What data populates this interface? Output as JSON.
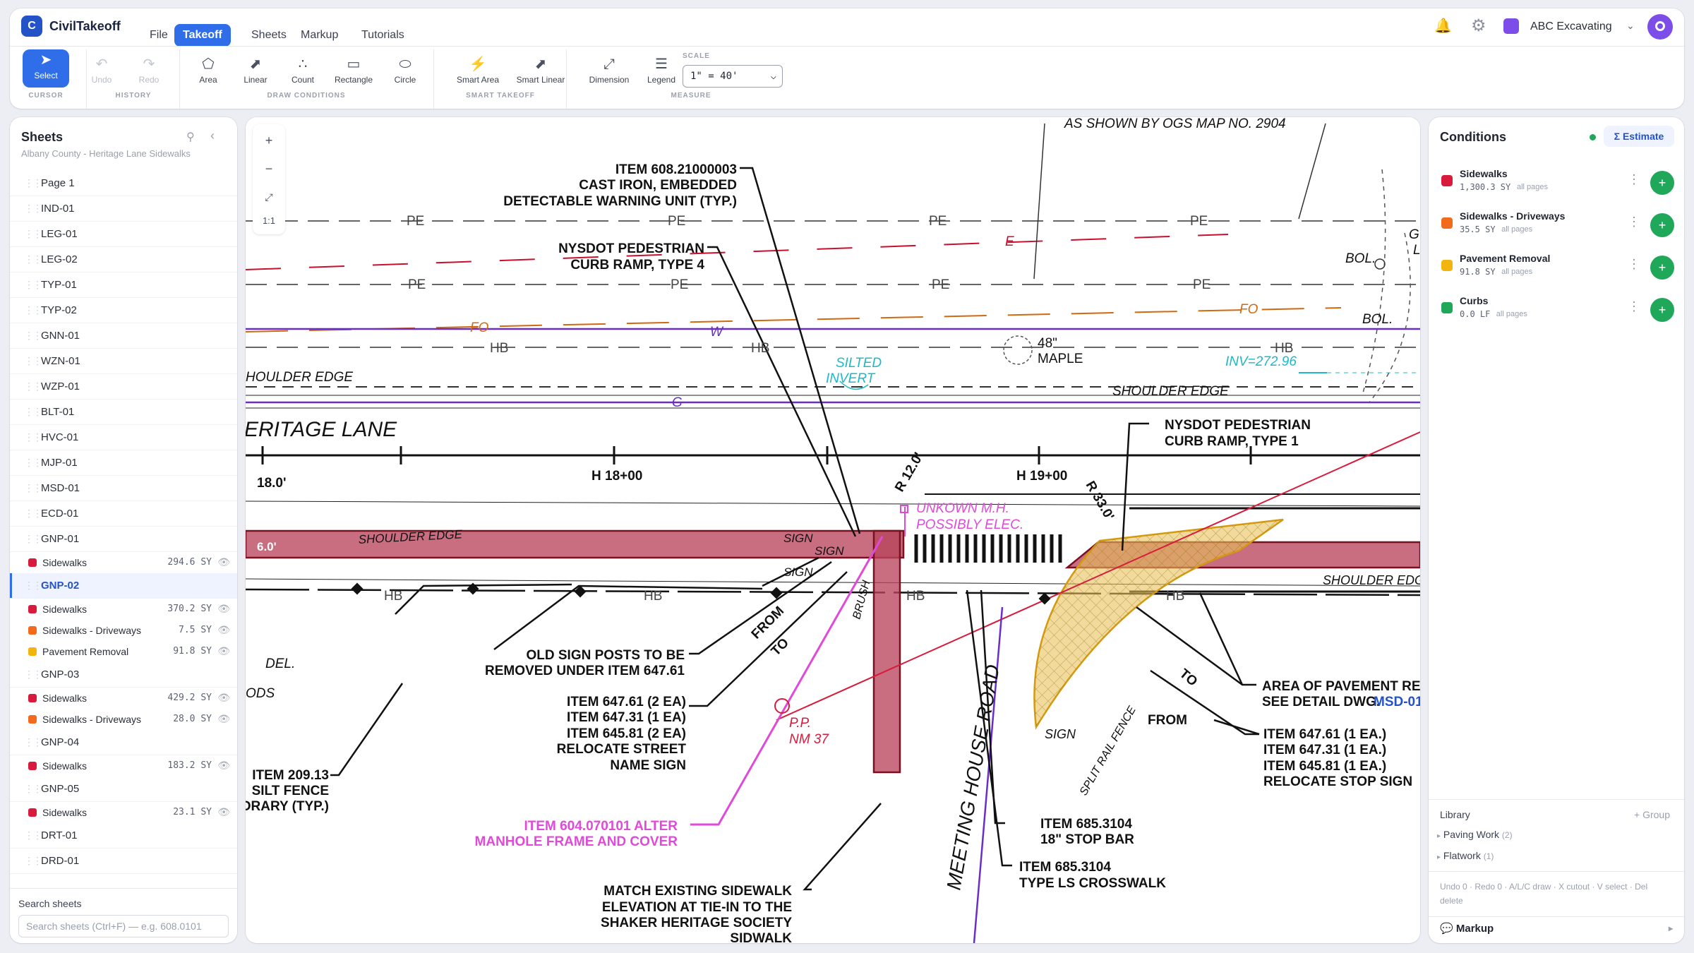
{
  "app": {
    "logo_letter": "C",
    "name": "CivilTakeoff"
  },
  "menu": {
    "file": "File",
    "takeoff": "Takeoff",
    "sheets": "Sheets",
    "markup": "Markup",
    "tutorials": "Tutorials"
  },
  "account": {
    "company": "ABC Excavating"
  },
  "toolbar": {
    "select": "Select",
    "undo": "Undo",
    "redo": "Redo",
    "area": "Area",
    "linear": "Linear",
    "count": "Count",
    "rectangle": "Rectangle",
    "circle": "Circle",
    "smart_area": "Smart Area",
    "smart_linear": "Smart Linear",
    "dimension": "Dimension",
    "legend": "Legend",
    "scale_label": "SCALE",
    "scale_value": "1\" = 40'",
    "groups": {
      "cursor": "CURSOR",
      "history": "HISTORY",
      "draw": "DRAW CONDITIONS",
      "smart": "SMART TAKEOFF",
      "measure": "MEASURE"
    }
  },
  "sheets_panel": {
    "title": "Sheets",
    "subtitle": "Albany County - Heritage Lane Sidewalks",
    "search_label": "Search sheets",
    "search_placeholder": "Search sheets (Ctrl+F) — e.g. 608.0101",
    "rows": [
      {
        "kind": "sheet",
        "name": "Page 1"
      },
      {
        "kind": "sheet",
        "name": "IND-01"
      },
      {
        "kind": "sheet",
        "name": "LEG-01"
      },
      {
        "kind": "sheet",
        "name": "LEG-02"
      },
      {
        "kind": "sheet",
        "name": "TYP-01"
      },
      {
        "kind": "sheet",
        "name": "TYP-02"
      },
      {
        "kind": "sheet",
        "name": "GNN-01"
      },
      {
        "kind": "sheet",
        "name": "WZN-01"
      },
      {
        "kind": "sheet",
        "name": "WZP-01"
      },
      {
        "kind": "sheet",
        "name": "BLT-01"
      },
      {
        "kind": "sheet",
        "name": "HVC-01"
      },
      {
        "kind": "sheet",
        "name": "MJP-01"
      },
      {
        "kind": "sheet",
        "name": "MSD-01"
      },
      {
        "kind": "sheet",
        "name": "ECD-01"
      },
      {
        "kind": "sheet",
        "name": "GNP-01"
      },
      {
        "kind": "cond",
        "name": "Sidewalks",
        "value": "294.6 SY",
        "color": "#d81b3c"
      },
      {
        "kind": "sheet",
        "name": "GNP-02",
        "active": true
      },
      {
        "kind": "cond",
        "name": "Sidewalks",
        "value": "370.2 SY",
        "color": "#d81b3c"
      },
      {
        "kind": "cond",
        "name": "Sidewalks - Driveways",
        "value": "7.5 SY",
        "color": "#f26a1b"
      },
      {
        "kind": "cond",
        "name": "Pavement Removal",
        "value": "91.8 SY",
        "color": "#f2b40f"
      },
      {
        "kind": "sheet",
        "name": "GNP-03"
      },
      {
        "kind": "cond",
        "name": "Sidewalks",
        "value": "429.2 SY",
        "color": "#d81b3c"
      },
      {
        "kind": "cond",
        "name": "Sidewalks - Driveways",
        "value": "28.0 SY",
        "color": "#f26a1b"
      },
      {
        "kind": "sheet",
        "name": "GNP-04"
      },
      {
        "kind": "cond",
        "name": "Sidewalks",
        "value": "183.2 SY",
        "color": "#d81b3c"
      },
      {
        "kind": "sheet",
        "name": "GNP-05"
      },
      {
        "kind": "cond",
        "name": "Sidewalks",
        "value": "23.1 SY",
        "color": "#d81b3c"
      },
      {
        "kind": "sheet",
        "name": "DRT-01"
      },
      {
        "kind": "sheet",
        "name": "DRD-01"
      }
    ]
  },
  "canvas_controls": {
    "zoom_in": "+",
    "zoom_out": "−",
    "fit": "⤢",
    "ratio": "1:1"
  },
  "drawing": {
    "notes": {
      "ogs": "AS SHOWN BY OGS MAP NO. 2904",
      "item608_1": "ITEM 608.21000003",
      "item608_2": "CAST IRON, EMBEDDED",
      "item608_3": "DETECTABLE WARNING UNIT (TYP.)",
      "ramp4_1": "NYSDOT PEDESTRIAN",
      "ramp4_2": "CURB RAMP, TYPE 4",
      "ramp1_1": "NYSDOT PEDESTRIAN",
      "ramp1_2": "CURB RAMP, TYPE 1",
      "silted_1": "SILTED",
      "silted_2": "INVERT",
      "maple_1": "48\"",
      "maple_2": "MAPLE",
      "inv": "INV=272.96",
      "shoulder_left": "HOULDER EDGE",
      "shoulder_mid": "SHOULDER EDGE",
      "shoulder_walk": "SHOULDER EDGE",
      "shoulder_right": "SHOULDER EDG",
      "street": "ERITAGE LANE",
      "dim18": "18.0'",
      "dim6": "6.0'",
      "sta18": "H 18+00",
      "sta19": "H 19+00",
      "r12": "R 12.0'",
      "r33": "R 33.0'",
      "unk_1": "UNKOWN M.H.",
      "unk_2": "POSSIBLY ELEC.",
      "bol1": "BOL.",
      "bol2": "BOL.",
      "oldsign_1": "OLD SIGN POSTS TO BE",
      "oldsign_2": "REMOVED UNDER ITEM 647.61",
      "item647a_1": "ITEM 647.61 (2 EA)",
      "item647a_2": "ITEM 647.31 (1 EA)",
      "item647a_3": "ITEM 645.81 (2 EA)",
      "item647a_4": "RELOCATE STREET",
      "item647a_5": "NAME SIGN",
      "silt_1": "ITEM 209.13",
      "silt_2": "SILT FENCE",
      "silt_3": "ORARY (TYP.)",
      "del": "DEL.",
      "ods": "ODS",
      "manhole_1": "ITEM 604.070101 ALTER",
      "manhole_2": "MANHOLE FRAME AND COVER",
      "pp_1": "P.P.",
      "pp_2": "NM 37",
      "match_1": "MATCH EXISTING SIDEWALK",
      "match_2": "ELEVATION AT TIE-IN TO THE",
      "match_3": "SHAKER HERITAGE SOCIETY",
      "match_4": "SIDWALK",
      "road": "MEETING HOUSE ROAD",
      "stopbar_1": "ITEM 685.3104",
      "stopbar_2": "18\" STOP BAR",
      "cross_1": "ITEM 685.3104",
      "cross_2": "TYPE LS CROSSWALK",
      "pave_1": "AREA OF PAVEMENT REMO",
      "pave_2": "SEE DETAIL DWG.",
      "pave_3": "MSD-01",
      "item647b_1": "ITEM 647.61 (1 EA.)",
      "item647b_2": "ITEM 647.31 (1 EA.)",
      "item647b_3": "ITEM 645.81 (1 EA.)",
      "item647b_4": "RELOCATE STOP SIGN",
      "from": "FROM",
      "to": "TO",
      "from2": "FROM",
      "to2": "TO",
      "sign": "SIGN",
      "sign2": "SIGN",
      "sign3": "SIGN",
      "sign4": "SIGN",
      "brush": "BRUSH",
      "split": "SPLIT RAIL FENCE",
      "pe": "PE",
      "hb": "HB",
      "fo": "FO",
      "w": "W",
      "g": "G",
      "e": "E",
      "gl1": "G",
      "gl2": "L"
    }
  },
  "conditions_panel": {
    "title": "Conditions",
    "estimate": "Σ Estimate",
    "all_pages": "all pages",
    "items": [
      {
        "name": "Sidewalks",
        "value": "1,300.3 SY",
        "color": "#d81b3c"
      },
      {
        "name": "Sidewalks - Driveways",
        "value": "35.5 SY",
        "color": "#f26a1b"
      },
      {
        "name": "Pavement Removal",
        "value": "91.8 SY",
        "color": "#f2b40f"
      },
      {
        "name": "Curbs",
        "value": "0.0 LF",
        "color": "#1fa85a"
      }
    ],
    "library": {
      "title": "Library",
      "group": "+ Group",
      "paving": "Paving Work",
      "paving_count": "(2)",
      "flatwork": "Flatwork",
      "flatwork_count": "(1)"
    },
    "shortcuts": "Undo 0 · Redo 0 · A/L/C draw · X cutout · V select · Del delete",
    "markup": "Markup"
  },
  "colors": {
    "accent": "#2f6ee8",
    "add": "#1fa85a",
    "sidewalk": "#d81b3c",
    "driveway": "#f26a1b",
    "pavement": "#f2b40f",
    "curbs": "#1fa85a"
  }
}
